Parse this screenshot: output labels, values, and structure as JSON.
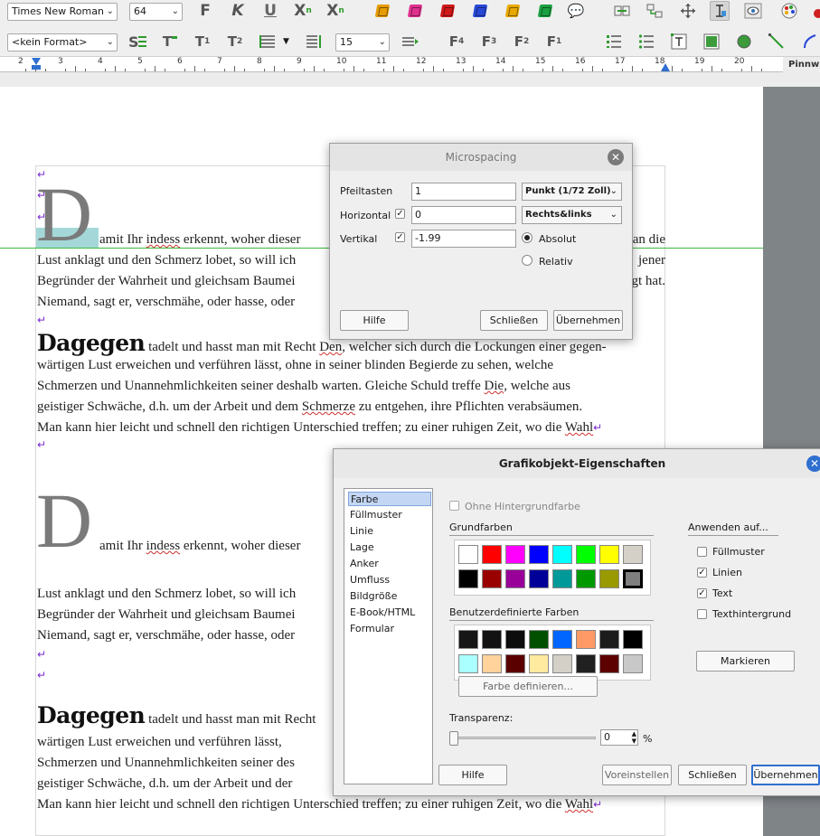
{
  "toolbar1": {
    "font_name": "Times New Roman",
    "font_size": "64",
    "bold": "F",
    "italic": "K",
    "underline": "U",
    "subscript": "X",
    "subscript_mark": "n",
    "superscript": "X",
    "superscript_mark": "n",
    "markers": [
      "#e69b00",
      "#e0308f",
      "#d01818",
      "#2848d8",
      "#e8a800",
      "#1aa040"
    ]
  },
  "toolbar2": {
    "style": "<kein Format>",
    "line_spacing": "15",
    "f4": "F",
    "f4_num": "4",
    "f3": "F",
    "f3_num": "3",
    "f2": "F",
    "f2_num": "2",
    "f1": "F",
    "f1_num": "1",
    "t": "T",
    "t1": "T",
    "t1_num": "1",
    "t2": "T",
    "t2_num": "2"
  },
  "ruler": {
    "numbers": [
      "2",
      "3",
      "4",
      "5",
      "6",
      "7",
      "8",
      "9",
      "10",
      "11",
      "12",
      "13",
      "14",
      "15",
      "16",
      "17",
      "18",
      "19",
      "20"
    ],
    "right_label": "Pinnw"
  },
  "document": {
    "drop_letter": "D",
    "p1_line1_start": "amit",
    "p1_line1_a": " Ihr ",
    "p1_line1_indess": "indess",
    "p1_line1_b": " erkennt, woher dieser",
    "p1_line1_end": "an die",
    "p1_line2": "Lust anklagt und den Schmerz lobet, so will ich",
    "p1_line2_end": "jener",
    "p1_line3": "Begründer der Wahrheit und gleichsam Baumei",
    "p1_line3_end": "gt hat.",
    "p1_line4": "Niemand, sagt er, verschmähe, oder hasse, oder",
    "dagegen": "Dagegen",
    "p2_line1_a": " tadelt und hasst man mit Recht ",
    "p2_line1_den": "Den",
    "p2_line1_b": ", welcher sich durch die Lockungen einer gegen-",
    "p2_line2": "wärtigen Lust erweichen und verführen lässt, ohne in seiner blinden Begierde zu sehen, welche",
    "p2_line3_a": "Schmerzen und Unannehmlichkeiten seiner deshalb warten. Gleiche Schuld treffe ",
    "p2_line3_die": "Die",
    "p2_line3_b": ", welche aus",
    "p2_line4_a": "geistiger Schwäche, d.h. um der Arbeit und dem ",
    "p2_line4_schmerze": "Schmerze",
    "p2_line4_b": " zu entgehen, ihre Pflichten verabsäumen.",
    "p2_line5_a": "Man kann hier leicht und schnell den richtigen Unterschied treffen; zu einer ruhigen Zeit, wo die ",
    "p2_line5_wahl": "Wahl",
    "p3_line1_a": "amit Ihr ",
    "p3_line1_indess": "indess",
    "p3_line1_b": " erkennt, woher dieser",
    "p3_line2": "Lust anklagt und den Schmerz lobet, so will ich",
    "p3_line3": "Begründer der Wahrheit und gleichsam Baumei",
    "p3_line4": "Niemand, sagt er, verschmähe, oder hasse, oder",
    "p4_line1": " tadelt und hasst man mit Recht",
    "p4_line2": "wärtigen Lust erweichen und verführen lässt,",
    "p4_line3": "Schmerzen und Unannehmlichkeiten seiner des",
    "p4_line4": "geistiger Schwäche, d.h. um der Arbeit und der",
    "p4_line5_a": "Man kann hier leicht und schnell den richtigen Unterschied treffen; zu einer ruhigen Zeit, wo die ",
    "p4_line5_wahl": "Wahl",
    "pilcrow": "↵"
  },
  "microspacing": {
    "title": "Microspacing",
    "pfeiltasten_label": "Pfeiltasten",
    "pfeiltasten_value": "1",
    "unit": "Punkt (1/72 Zoll)",
    "horizontal_label": "Horizontal",
    "horizontal_value": "0",
    "horizontal_mode": "Rechts&links",
    "vertikal_label": "Vertikal",
    "vertikal_value": "-1.99",
    "absolut_label": "Absolut",
    "relativ_label": "Relativ",
    "hilfe": "Hilfe",
    "schliessen": "Schließen",
    "uebernehmen": "Übernehmen"
  },
  "grafik": {
    "title": "Grafikobjekt-Eigenschaften",
    "categories": [
      "Farbe",
      "Füllmuster",
      "Linie",
      "Lage",
      "Anker",
      "Umfluss",
      "Bildgröße",
      "E-Book/HTML",
      "Formular"
    ],
    "ohne_hintergrund": "Ohne Hintergrundfarbe",
    "grundfarben_label": "Grundfarben",
    "grundfarben_row1": [
      "#ffffff",
      "#ff0000",
      "#ff00ff",
      "#0000ff",
      "#00ffff",
      "#00ff00",
      "#ffff00",
      "#d4d0c8"
    ],
    "grundfarben_row2": [
      "#000000",
      "#990000",
      "#990099",
      "#000099",
      "#009999",
      "#009900",
      "#999900",
      "#7f7f7f"
    ],
    "benutzer_label": "Benutzerdefinierte Farben",
    "benutzer_row1": [
      "#161616",
      "#121212",
      "#0c0c0c",
      "#005000",
      "#0066ff",
      "#ff9966",
      "#1c1c1c",
      "#000000"
    ],
    "benutzer_row2": [
      "#aaffff",
      "#ffd39b",
      "#5a0000",
      "#ffeaa0",
      "#d4d0c8",
      "#202020",
      "#5c0000",
      "#c8c8c8"
    ],
    "farbe_definieren": "Farbe definieren...",
    "transparenz_label": "Transparenz:",
    "transparenz_value": "0",
    "percent": "%",
    "anwenden_label": "Anwenden auf...",
    "apply_fuellmuster": "Füllmuster",
    "apply_linien": "Linien",
    "apply_text": "Text",
    "apply_texthintergrund": "Texthintergrund",
    "markieren": "Markieren",
    "hilfe": "Hilfe",
    "voreinstellen": "Voreinstellen",
    "schliessen": "Schließen",
    "uebernehmen": "Übernehmen"
  }
}
